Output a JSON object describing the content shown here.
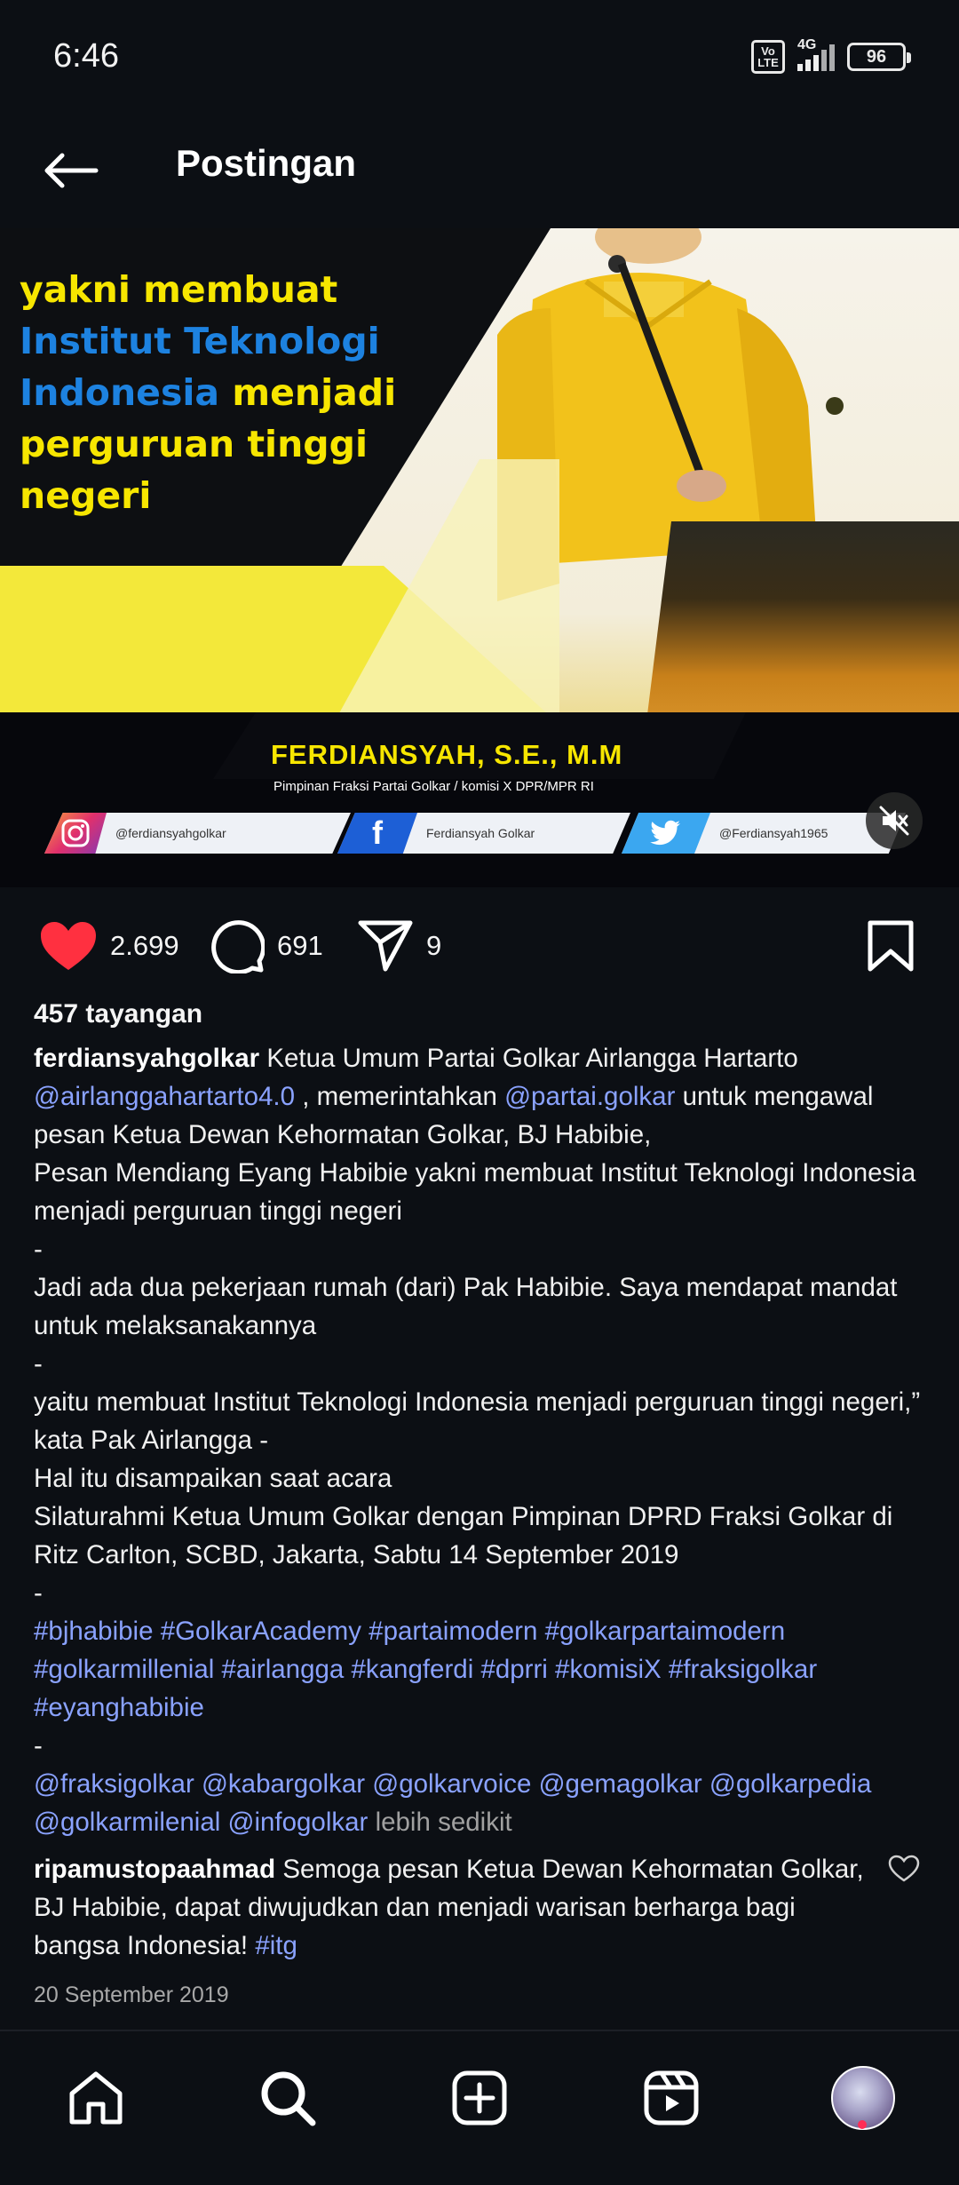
{
  "status_bar": {
    "time": "6:46",
    "network_badge": "Vo LTE",
    "network_type": "4G",
    "battery": "96"
  },
  "header": {
    "title": "Postingan"
  },
  "post_image": {
    "headline_line1": "yakni membuat",
    "headline_line2": "Institut Teknologi",
    "headline_line3a": "Indonesia",
    "headline_line3b": " menjadi",
    "headline_line4": "perguruan tinggi",
    "headline_line5": "negeri",
    "speaker_name": "FERDIANSYAH, S.E., M.M",
    "speaker_title": "Pimpinan Fraksi Partai Golkar / komisi X DPR/MPR RI",
    "instagram_handle": "@ferdiansyahgolkar",
    "facebook_handle": "Ferdiansyah Golkar",
    "twitter_handle": "@Ferdiansyah1965"
  },
  "actions": {
    "likes": "2.699",
    "comments": "691",
    "shares": "9"
  },
  "post": {
    "views": "457 tayangan",
    "username": "ferdiansyahgolkar",
    "caption_p1": " Ketua Umum Partai Golkar Airlangga Hartarto ",
    "mention1": "@airlanggahartarto4.0",
    "caption_p2": " , memerintahkan ",
    "mention2": "@partai.golkar",
    "caption_p3": " untuk mengawal pesan Ketua Dewan Kehormatan Golkar, BJ Habibie,",
    "line_pesan": "Pesan Mendiang Eyang Habibie yakni membuat Institut Teknologi Indonesia menjadi perguruan tinggi negeri",
    "sep": "-",
    "line_jadi": "Jadi ada dua pekerjaan rumah (dari) Pak Habibie. Saya mendapat mandat untuk melaksanakannya",
    "line_yaitu": "yaitu membuat Institut Teknologi Indonesia menjadi perguruan tinggi negeri,” kata Pak Airlangga -",
    "line_hal": "Hal itu disampaikan saat acara",
    "line_silaturahmi": "Silaturahmi Ketua Umum Golkar dengan Pimpinan DPRD Fraksi Golkar di Ritz Carlton, SCBD, Jakarta, Sabtu 14 September 2019",
    "hashtags": "#bjhabibie #GolkarAcademy #partaimodern #golkarpartaimodern #golkarmillenial #airlangga #kangferdi #dprri #komisiX #fraksigolkar #eyanghabibie",
    "mentions": "@fraksigolkar @kabargolkar @golkarvoice @gemagolkar @golkarpedia @golkarmilenial @infogolkar",
    "less_label": "lebih sedikit"
  },
  "comment": {
    "username": "ripamustopaahmad",
    "text": " Semoga pesan Ketua Dewan Kehormatan Golkar, BJ Habibie, dapat diwujudkan dan menjadi warisan berharga bagi bangsa Indonesia! ",
    "tag": "#itg"
  },
  "post_date": "20 September 2019",
  "colors": {
    "background": "#0c0f14",
    "link": "#8aa2ff",
    "like": "#ff3040",
    "headline_yellow": "#f7e600",
    "headline_blue": "#1d82e0"
  },
  "icons": {
    "back": "arrow-left-icon",
    "like": "heart-filled-icon",
    "comment": "speech-bubble-icon",
    "share": "paper-plane-icon",
    "save": "bookmark-icon",
    "home": "home-icon",
    "search": "search-icon",
    "create": "plus-square-icon",
    "reels": "reels-icon",
    "mute": "speaker-muted-icon"
  }
}
